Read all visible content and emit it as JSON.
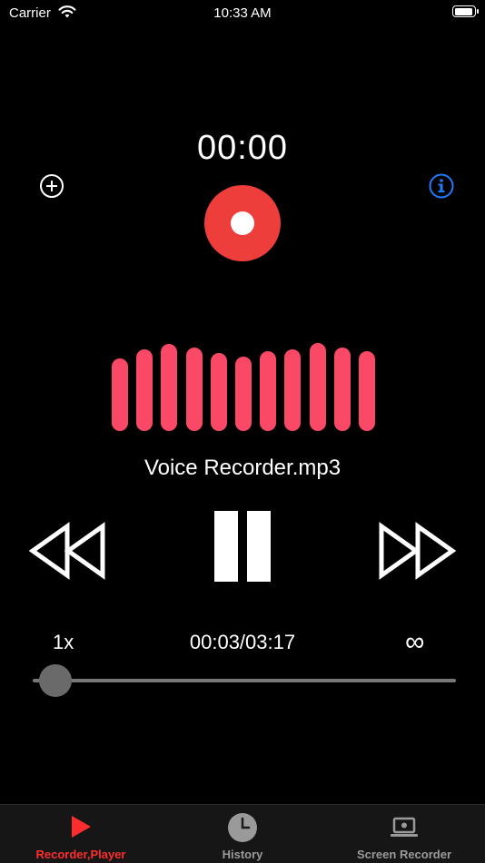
{
  "status_bar": {
    "carrier": "Carrier",
    "time": "10:33 AM"
  },
  "recorder": {
    "timer": "00:00",
    "accent_color": "#ee3e3c"
  },
  "visualizer": {
    "bar_levels": [
      0.8,
      0.9,
      0.96,
      0.92,
      0.86,
      0.82,
      0.88,
      0.9,
      0.97,
      0.92,
      0.88
    ],
    "bar_color": "#fa4966"
  },
  "player": {
    "file_name": "Voice Recorder.mp3",
    "speed": "1x",
    "progress_time": "00:03/03:17",
    "loop_symbol": "∞",
    "progress_fraction": 0.015
  },
  "tabs": [
    {
      "label": "Recorder,Player",
      "icon": "play-icon",
      "active": true
    },
    {
      "label": "History",
      "icon": "clock-icon",
      "active": false
    },
    {
      "label": "Screen Recorder",
      "icon": "laptop-icon",
      "active": false
    }
  ],
  "colors": {
    "active_tab": "#ff2d2d",
    "inactive_tab": "#9a9a9a",
    "info": "#1f7cff"
  }
}
